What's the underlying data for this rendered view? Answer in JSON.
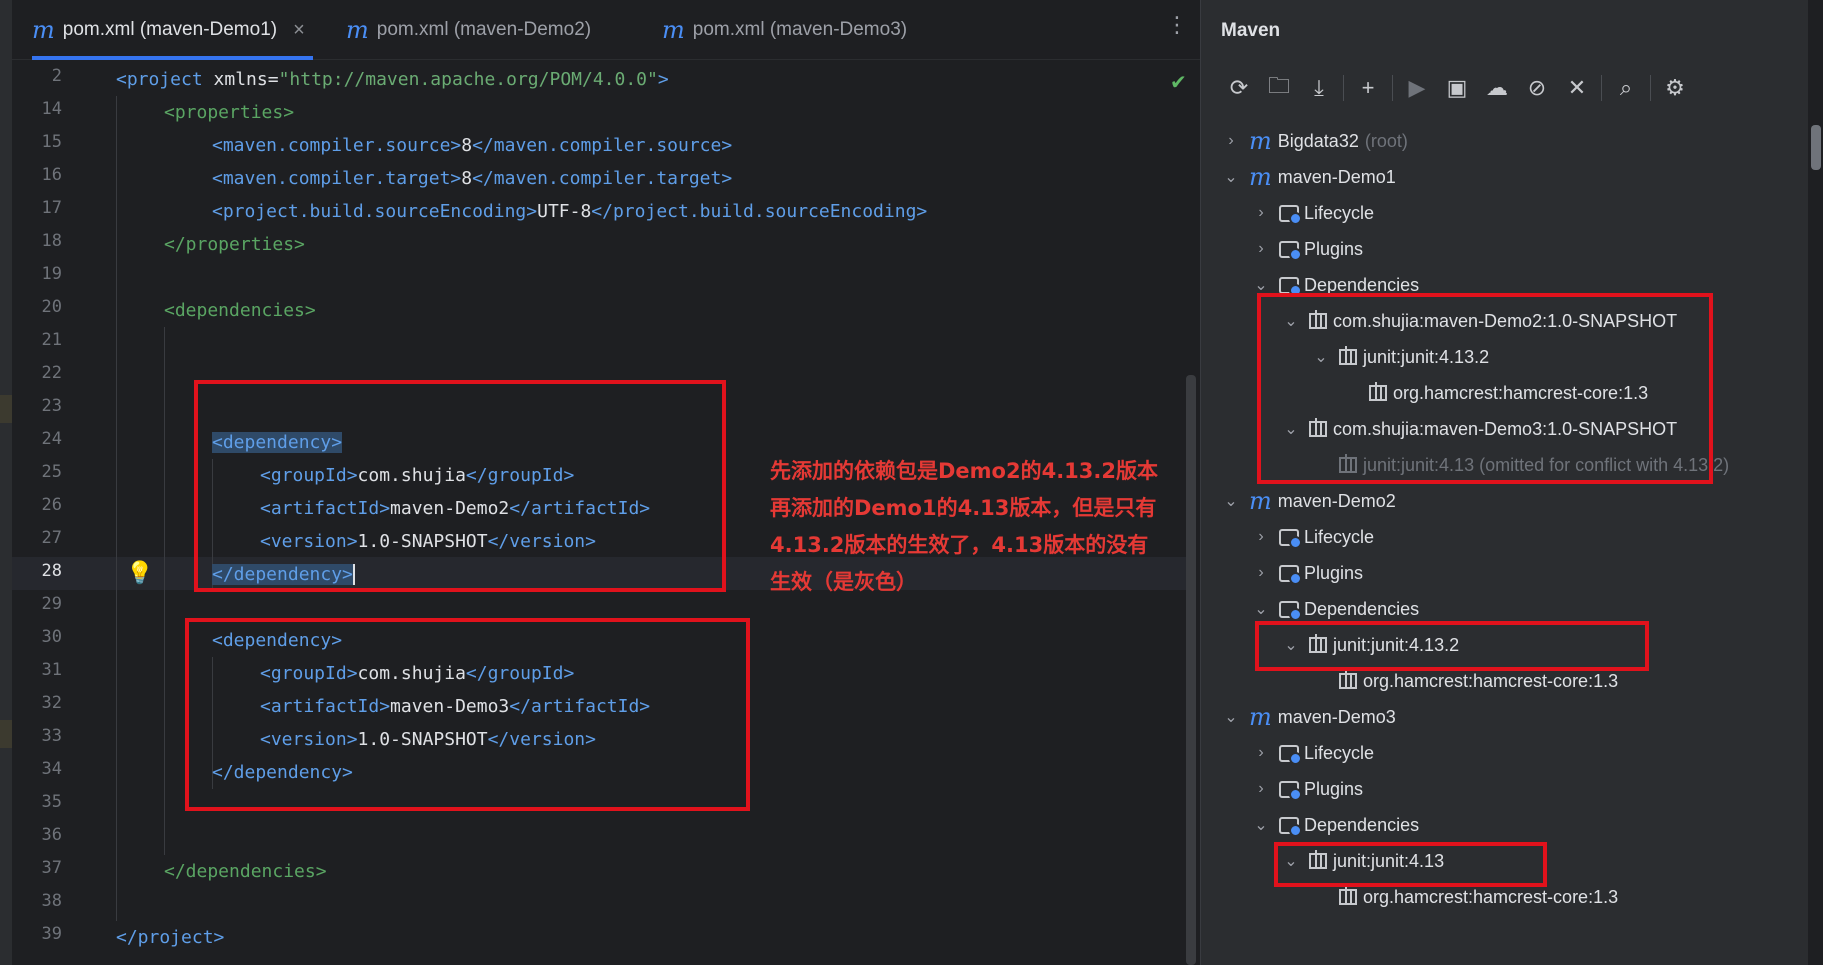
{
  "tabs": [
    {
      "label": "pom.xml (maven-Demo1)",
      "active": true
    },
    {
      "label": "pom.xml (maven-Demo2)",
      "active": false
    },
    {
      "label": "pom.xml (maven-Demo3)",
      "active": false
    }
  ],
  "tab_close_glyph": "×",
  "editor": {
    "lines": [
      {
        "no": "2"
      },
      {
        "no": "14"
      },
      {
        "no": "15"
      },
      {
        "no": "16"
      },
      {
        "no": "17"
      },
      {
        "no": "18"
      },
      {
        "no": "19"
      },
      {
        "no": "20"
      },
      {
        "no": "21"
      },
      {
        "no": "22"
      },
      {
        "no": "23"
      },
      {
        "no": "24"
      },
      {
        "no": "25"
      },
      {
        "no": "26"
      },
      {
        "no": "27"
      },
      {
        "no": "28"
      },
      {
        "no": "29"
      },
      {
        "no": "30"
      },
      {
        "no": "31"
      },
      {
        "no": "32"
      },
      {
        "no": "33"
      },
      {
        "no": "34"
      },
      {
        "no": "35"
      },
      {
        "no": "36"
      },
      {
        "no": "37"
      },
      {
        "no": "38"
      },
      {
        "no": "39"
      }
    ],
    "current_line": "28",
    "code": {
      "l2_open": "<project",
      "l2_attr": " xmlns=",
      "l2_val": "\"http://maven.apache.org/POM/4.0.0\"",
      "l2_close": ">",
      "l14": "<properties>",
      "l15_open": "<maven.compiler.source>",
      "l15_val": "8",
      "l15_close": "</maven.compiler.source>",
      "l16_open": "<maven.compiler.target>",
      "l16_val": "8",
      "l16_close": "</maven.compiler.target>",
      "l17_open": "<project.build.sourceEncoding>",
      "l17_val": "UTF-8",
      "l17_close": "</project.build.sourceEncoding>",
      "l18": "</properties>",
      "l20": "<dependencies>",
      "dep1_open": "<dependency>",
      "dep1_group_open": "<groupId>",
      "dep1_group_val": "com.shujia",
      "dep1_group_close": "</groupId>",
      "dep1_art_open": "<artifactId>",
      "dep1_art_val": "maven-Demo2",
      "dep1_art_close": "</artifactId>",
      "dep1_ver_open": "<version>",
      "dep1_ver_val": "1.0-SNAPSHOT",
      "dep1_ver_close": "</version>",
      "dep1_close": "</dependency>",
      "dep2_open": "<dependency>",
      "dep2_group_open": "<groupId>",
      "dep2_group_val": "com.shujia",
      "dep2_group_close": "</groupId>",
      "dep2_art_open": "<artifactId>",
      "dep2_art_val": "maven-Demo3",
      "dep2_art_close": "</artifactId>",
      "dep2_ver_open": "<version>",
      "dep2_ver_val": "1.0-SNAPSHOT",
      "dep2_ver_close": "</version>",
      "dep2_close": "</dependency>",
      "l37": "</dependencies>",
      "l39": "</project>"
    }
  },
  "annotation": {
    "line1": "先添加的依赖包是Demo2的4.13.2版本",
    "line2": "再添加的Demo1的4.13版本，但是只有",
    "line3": "4.13.2版本的生效了，4.13版本的没有",
    "line4": "生效（是灰色）"
  },
  "maven": {
    "title": "Maven",
    "tree": {
      "root_name": "Bigdata32",
      "root_suffix": "(root)",
      "demo1": "maven-Demo1",
      "lifecycle": "Lifecycle",
      "plugins": "Plugins",
      "dependencies": "Dependencies",
      "demo1_dep1": "com.shujia:maven-Demo2:1.0-SNAPSHOT",
      "demo1_dep1_child": "junit:junit:4.13.2",
      "demo1_dep1_grandchild": "org.hamcrest:hamcrest-core:1.3",
      "demo1_dep2": "com.shujia:maven-Demo3:1.0-SNAPSHOT",
      "demo1_dep2_child": "junit:junit:4.13 (omitted for conflict with 4.13.2)",
      "demo2": "maven-Demo2",
      "demo2_dep": "junit:junit:4.13.2",
      "demo2_dep_child": "org.hamcrest:hamcrest-core:1.3",
      "demo3": "maven-Demo3",
      "demo3_dep": "junit:junit:4.13",
      "demo3_dep_child": "org.hamcrest:hamcrest-core:1.3"
    }
  },
  "colors": {
    "accent": "#3574f0",
    "annotation_red": "#e1121c",
    "xml_tag": "#5f9ee8",
    "xml_string": "#6aab73"
  }
}
